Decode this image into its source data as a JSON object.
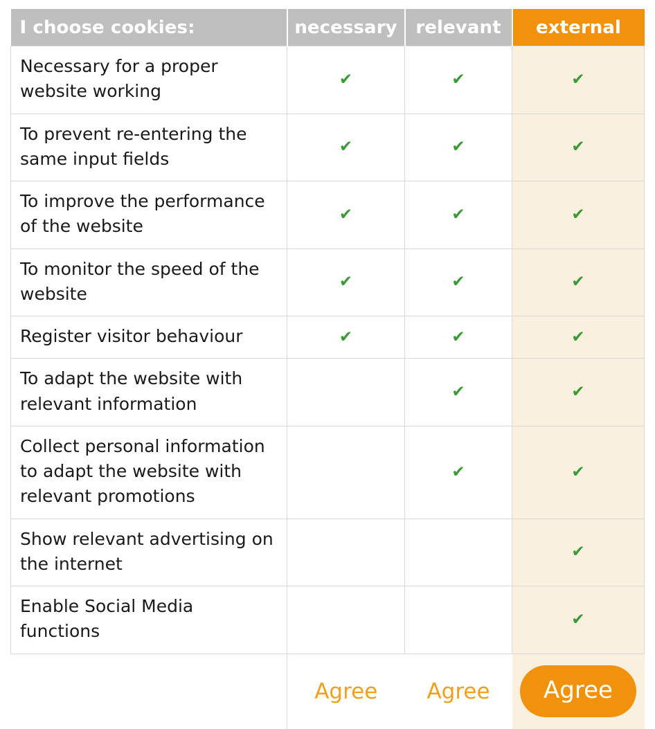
{
  "table": {
    "columns": [
      {
        "key": "description",
        "label": "I choose cookies:",
        "style": "header-gray"
      },
      {
        "key": "necessary",
        "label": "necessary",
        "style": "header-gray"
      },
      {
        "key": "relevant",
        "label": "relevant",
        "style": "header-gray"
      },
      {
        "key": "external",
        "label": "external",
        "style": "header-orange"
      }
    ],
    "check_glyph": "✔",
    "rows": [
      {
        "description": "Necessary for a proper website working",
        "necessary": true,
        "relevant": true,
        "external": true
      },
      {
        "description": "To prevent re-entering the same input fields",
        "necessary": true,
        "relevant": true,
        "external": true
      },
      {
        "description": "To improve the performance of the website",
        "necessary": true,
        "relevant": true,
        "external": true
      },
      {
        "description": "To monitor the speed of the website",
        "necessary": true,
        "relevant": true,
        "external": true
      },
      {
        "description": "Register visitor behaviour",
        "necessary": true,
        "relevant": true,
        "external": true
      },
      {
        "description": "To adapt the website with relevant information",
        "necessary": false,
        "relevant": true,
        "external": true
      },
      {
        "description": "Collect personal information to adapt the website with relevant promotions",
        "necessary": false,
        "relevant": true,
        "external": true
      },
      {
        "description": "Show relevant advertising on the internet",
        "necessary": false,
        "relevant": false,
        "external": true
      },
      {
        "description": "Enable Social Media functions",
        "necessary": false,
        "relevant": false,
        "external": true
      }
    ],
    "footer": {
      "description_label": "",
      "necessary_agree_label": "Agree",
      "relevant_agree_label": "Agree",
      "external_agree_label": "Agree"
    }
  },
  "colors": {
    "header_gray": "#bfbfbf",
    "header_orange": "#f0920b",
    "external_column_tint": "#faf0df",
    "check_green": "#3a9a34",
    "agree_link_orange": "#f2a01c",
    "agree_button_orange": "#f0920b",
    "grid_line": "#d8d8d8",
    "header_text": "#ffffff",
    "body_text": "#1a1a1a"
  }
}
